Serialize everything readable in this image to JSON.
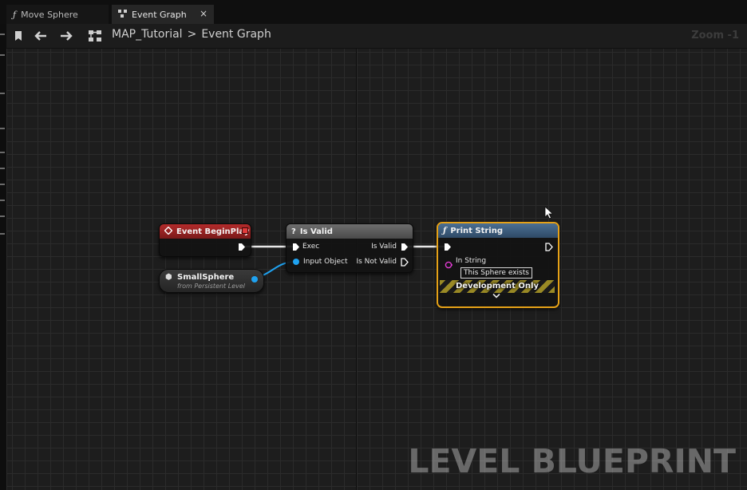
{
  "tabs": [
    {
      "label": "Move Sphere",
      "icon": "function-icon"
    },
    {
      "label": "Event Graph",
      "icon": "graph-icon",
      "close": "×"
    }
  ],
  "breadcrumb": {
    "level": "MAP_Tutorial",
    "separator": ">",
    "graph": "Event Graph"
  },
  "zoom": "Zoom -1",
  "nodes": {
    "begin_play": {
      "title": "Event BeginPlay",
      "color": "#b32b2b"
    },
    "small_sphere": {
      "name": "SmallSphere",
      "subtitle": "from Persistent Level"
    },
    "is_valid": {
      "title": "Is Valid",
      "icon": "?",
      "pins": {
        "exec": "Exec",
        "input_object": "Input Object",
        "is_valid": "Is Valid",
        "is_not_valid": "Is Not Valid"
      }
    },
    "print_string": {
      "title": "Print String",
      "icon": "function-icon",
      "pins": {
        "in_string": "In String"
      },
      "in_string_value": "This Sphere exists",
      "development_only": "Development Only",
      "border_color": "#e5a117"
    }
  },
  "watermark": "LEVEL BLUEPRINT"
}
